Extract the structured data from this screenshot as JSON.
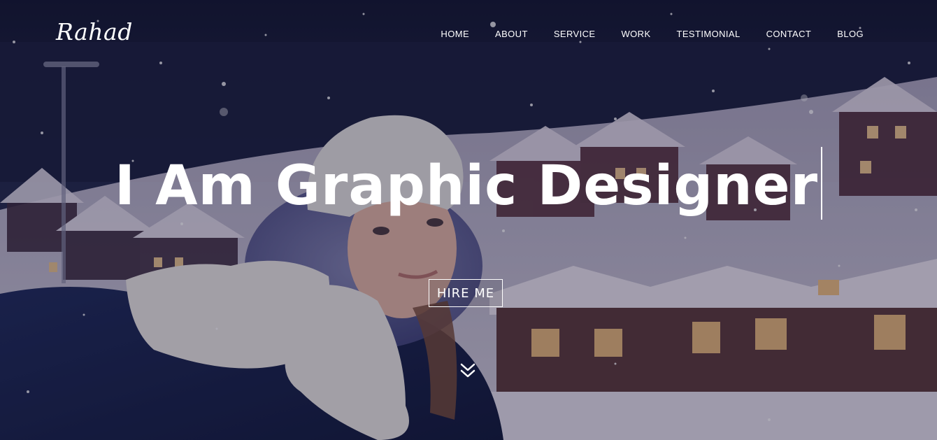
{
  "header": {
    "logo": "Rahad",
    "nav": [
      {
        "label": "HOME"
      },
      {
        "label": "ABOUT"
      },
      {
        "label": "SERVICE"
      },
      {
        "label": "WORK"
      },
      {
        "label": "TESTIMONIAL"
      },
      {
        "label": "CONTACT"
      },
      {
        "label": "BLOG"
      }
    ]
  },
  "hero": {
    "headline": "I Am Graphic Designer",
    "cta_label": "HIRE ME",
    "scroll_icon": "double-chevron-down-icon",
    "background_image": "woman-in-snowy-village-photo"
  },
  "colors": {
    "text": "#ffffff",
    "overlay": "#14122d"
  }
}
